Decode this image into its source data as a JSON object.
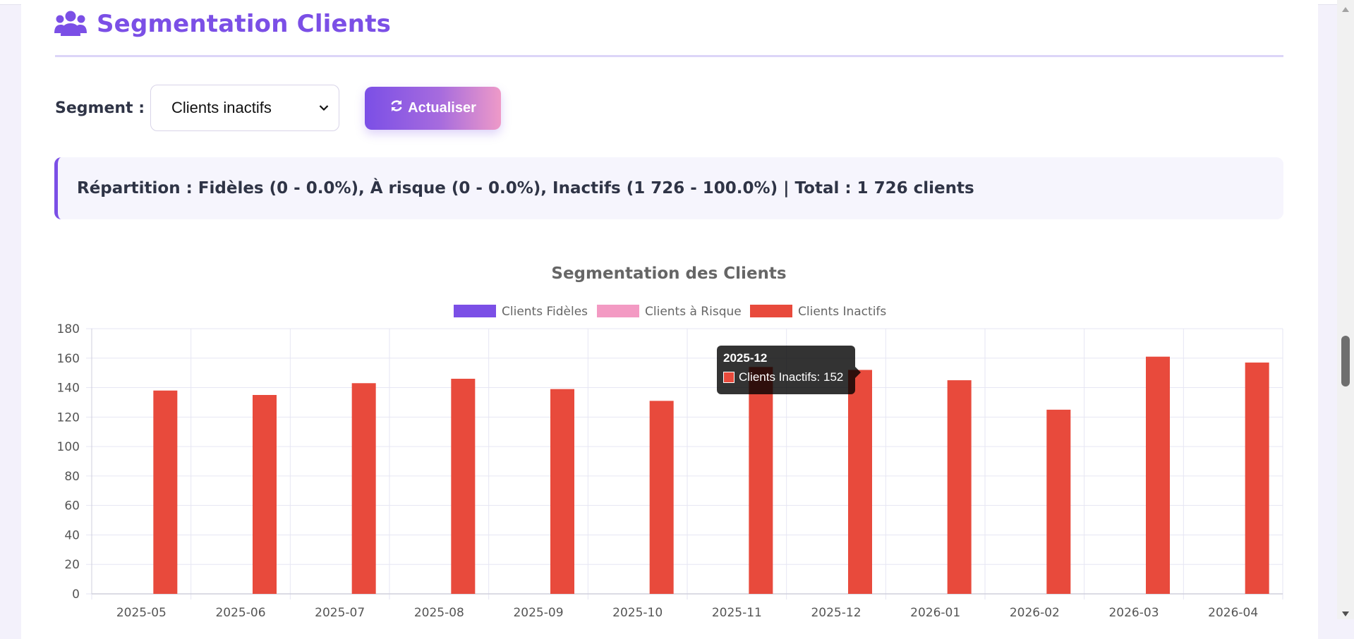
{
  "header": {
    "title": "Segmentation Clients",
    "icon": "users-icon",
    "accent": "#7b4fe6"
  },
  "controls": {
    "segment_label": "Segment :",
    "segment_selected": "Clients inactifs",
    "refresh_label": "Actualiser"
  },
  "info": {
    "text": "Répartition : Fidèles (0 - 0.0%), À risque (0 - 0.0%), Inactifs (1 726 - 100.0%) | Total : 1 726 clients"
  },
  "chart_data": {
    "type": "bar",
    "title": "Segmentation des Clients",
    "categories": [
      "2025-05",
      "2025-06",
      "2025-07",
      "2025-08",
      "2025-09",
      "2025-10",
      "2025-11",
      "2025-12",
      "2026-01",
      "2026-02",
      "2026-03",
      "2026-04"
    ],
    "series": [
      {
        "name": "Clients Fidèles",
        "color": "#7b4fe6",
        "values": [
          0,
          0,
          0,
          0,
          0,
          0,
          0,
          0,
          0,
          0,
          0,
          0
        ]
      },
      {
        "name": "Clients à Risque",
        "color": "#f39ac3",
        "values": [
          0,
          0,
          0,
          0,
          0,
          0,
          0,
          0,
          0,
          0,
          0,
          0
        ]
      },
      {
        "name": "Clients Inactifs",
        "color": "#e84a3c",
        "values": [
          138,
          135,
          143,
          146,
          139,
          131,
          154,
          152,
          145,
          125,
          161,
          157
        ]
      }
    ],
    "ylim": [
      0,
      180
    ],
    "yticks": [
      0,
      20,
      40,
      60,
      80,
      100,
      120,
      140,
      160,
      180
    ],
    "grid": true,
    "legend": "top-center"
  },
  "tooltip": {
    "title": "2025-12",
    "text": "Clients Inactifs: 152"
  }
}
